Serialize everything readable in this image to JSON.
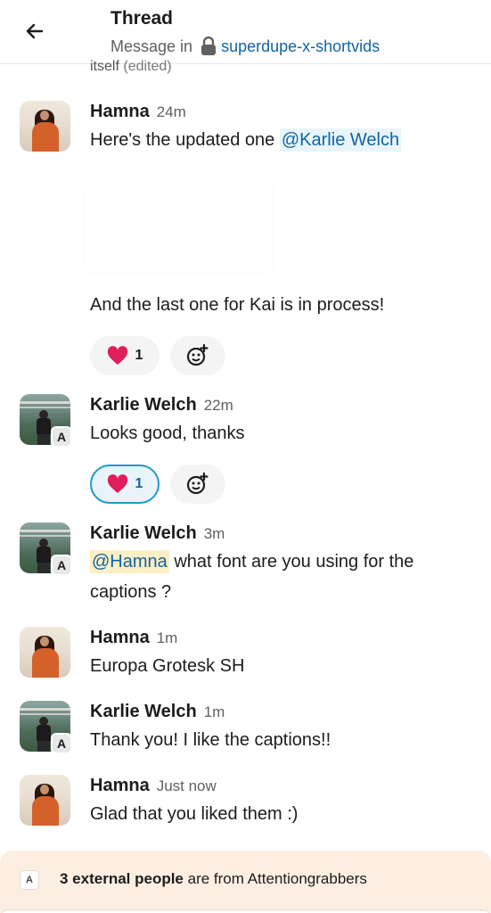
{
  "header": {
    "title": "Thread",
    "subtitle_prefix": "Message in",
    "channel": "superdupe-x-shortvids"
  },
  "clipped_text": {
    "text": "itself",
    "edited": "(edited)"
  },
  "messages": [
    {
      "author": "Hamna",
      "time": "24m",
      "lines": [
        "Here's the updated one ",
        "@Karlie Welch"
      ],
      "extra": "And the last one for Kai is in process!",
      "reaction_count": "1"
    },
    {
      "author": "Karlie Welch",
      "time": "22m",
      "text": "Looks good, thanks",
      "reaction_count": "1",
      "badge": "A"
    },
    {
      "author": "Karlie Welch",
      "time": "3m",
      "mention": "@Hamna",
      "text1": " what font are you using for the",
      "text2": "captions ?",
      "badge": "A"
    },
    {
      "author": "Hamna",
      "time": "1m",
      "text": "Europa Grotesk SH"
    },
    {
      "author": "Karlie Welch",
      "time": "1m",
      "text": "Thank you! I like the captions!!",
      "badge": "A"
    },
    {
      "author": "Hamna",
      "time": "Just now",
      "text": "Glad that you liked them :)"
    }
  ],
  "banner": {
    "badge": "A",
    "bold": "3 external people",
    "rest": " are from Attentiongrabbers"
  },
  "icons": {
    "back": "arrow-left-icon",
    "lock": "lock-icon",
    "heart": "heart-icon",
    "add_reaction": "add-reaction-icon"
  },
  "colors": {
    "link": "#1264a3",
    "heart": "#e01e5a",
    "banner_bg": "#fcefe2"
  }
}
